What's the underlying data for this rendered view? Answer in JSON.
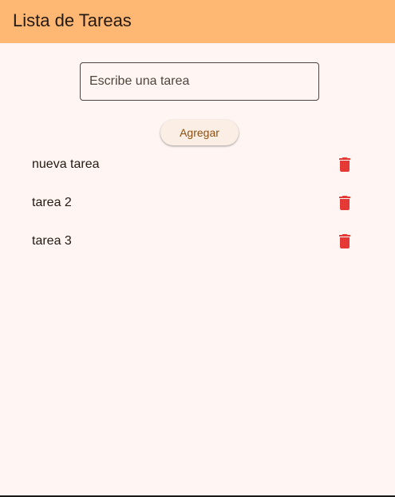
{
  "app_bar": {
    "title": "Lista de Tareas",
    "color": "#ffb774"
  },
  "task_input": {
    "value": "",
    "placeholder": "Escribe una tarea"
  },
  "add_button": {
    "label": "Agregar"
  },
  "tasks": [
    {
      "label": "nueva tarea",
      "delete_icon": "delete-icon"
    },
    {
      "label": "tarea 2",
      "delete_icon": "delete-icon"
    },
    {
      "label": "tarea 3",
      "delete_icon": "delete-icon"
    }
  ],
  "colors": {
    "background": "#fff6f3",
    "delete_icon": "#e53935"
  }
}
